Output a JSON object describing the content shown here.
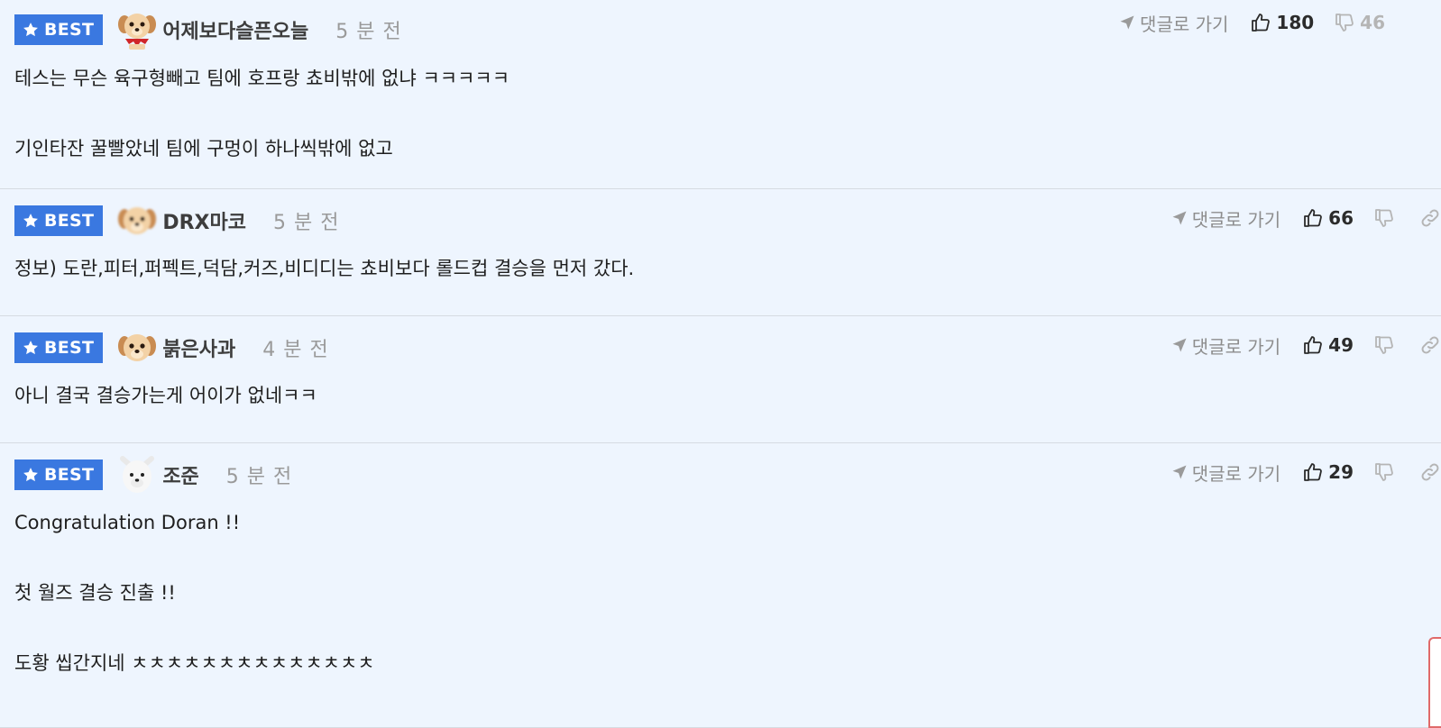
{
  "comments": [
    {
      "badge": "BEST",
      "nickname": "어제보다슬픈오늘",
      "time": "5 분 전",
      "goto_label": "댓글로 가기",
      "likes": "180",
      "dislikes": "46",
      "avatar": "puppy-red-scarf",
      "body": "테스는 무슨 육구형빼고 팀에 호프랑 쵸비밖에 없냐 ㅋㅋㅋㅋㅋ\n\n기인타잔 꿀빨았네 팀에 구멍이 하나씩밖에 없고"
    },
    {
      "badge": "BEST",
      "nickname": "DRX마코",
      "time": "5 분 전",
      "goto_label": "댓글로 가기",
      "likes": "66",
      "dislikes": "",
      "avatar": "puppy-blurred",
      "body": "정보) 도란,피터,퍼펙트,덕담,커즈,비디디는 쵸비보다 롤드컵 결승을 먼저 갔다."
    },
    {
      "badge": "BEST",
      "nickname": "붉은사과",
      "time": "4 분 전",
      "goto_label": "댓글로 가기",
      "likes": "49",
      "dislikes": "",
      "avatar": "puppy",
      "body": "아니 결국 결승가는게 어이가 없네ㅋㅋ"
    },
    {
      "badge": "BEST",
      "nickname": "조준",
      "time": "5 분 전",
      "goto_label": "댓글로 가기",
      "likes": "29",
      "dislikes": "",
      "avatar": "white-dog",
      "body": "Congratulation Doran !!\n\n첫 월즈 결승 진출 !!\n\n도황 씹간지네 ㅊㅊㅊㅊㅊㅊㅊㅊㅊㅊㅊㅊㅊㅊ"
    }
  ],
  "colors": {
    "background": "#eef5fe",
    "badge": "#3a78e0",
    "divider": "#d6dbe2"
  }
}
